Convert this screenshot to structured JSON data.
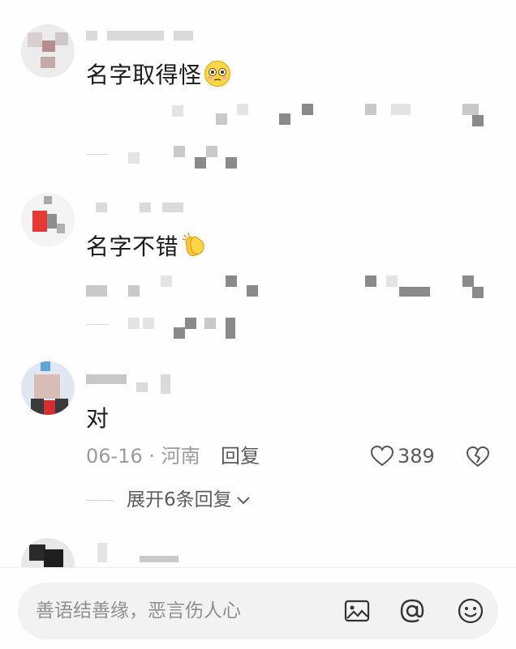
{
  "comments": [
    {
      "text": "名字取得怪",
      "emoji_icon": "flushed-face-emoji"
    },
    {
      "text": "名字不错",
      "emoji_icon": "clapping-hands-emoji"
    },
    {
      "text": "对",
      "date": "06-16",
      "separator": "·",
      "location": "河南",
      "reply_label": "回复",
      "like_count": "389",
      "expand_label": "展开6条回复"
    }
  ],
  "composer": {
    "placeholder": "善语结善缘，恶言伤人心",
    "icons": [
      "image-icon",
      "at-mention-icon",
      "emoji-icon"
    ]
  },
  "colors": {
    "background": "#fefefe",
    "pill": "#f2f2f2",
    "muted_text": "#9b9b9b"
  }
}
